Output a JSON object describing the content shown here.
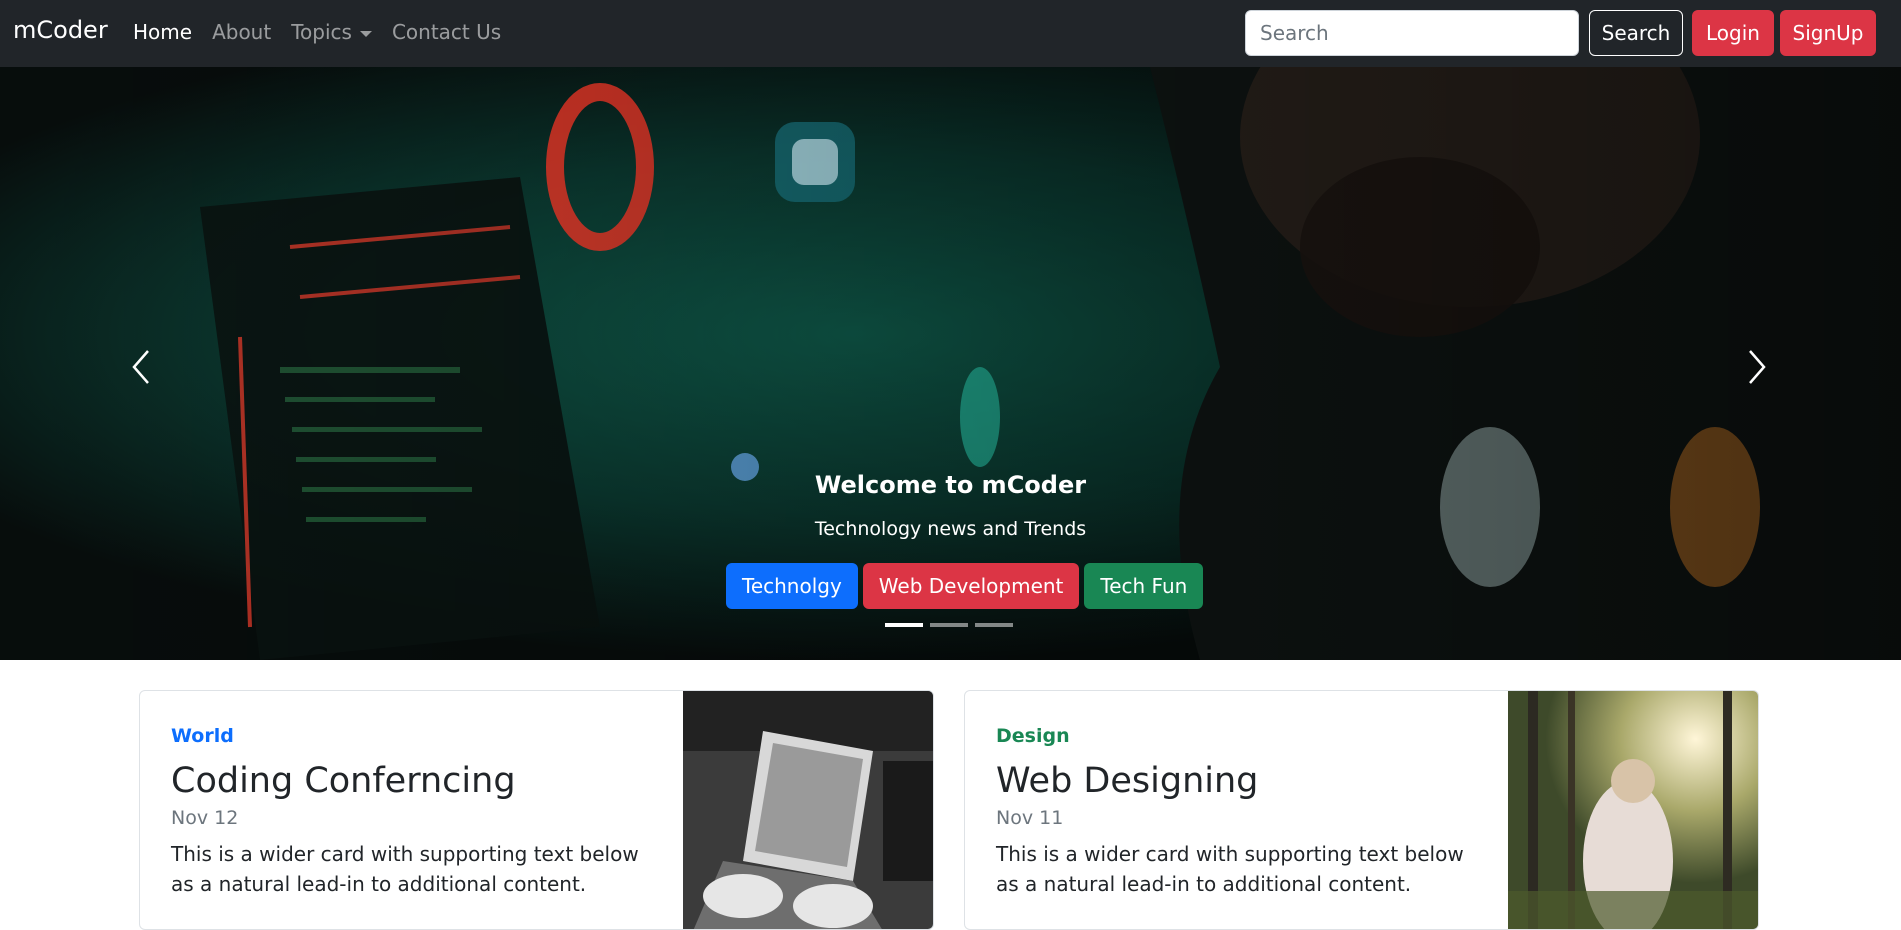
{
  "navbar": {
    "brand": "mCoder",
    "links": [
      {
        "label": "Home",
        "active": true
      },
      {
        "label": "About",
        "active": false
      },
      {
        "label": "Topics",
        "active": false,
        "dropdown": true
      },
      {
        "label": "Contact Us",
        "active": false
      }
    ],
    "search": {
      "placeholder": "Search",
      "value": ""
    },
    "search_button": "Search",
    "login_button": "Login",
    "signup_button": "SignUp"
  },
  "carousel": {
    "caption_title": "Welcome to mCoder",
    "caption_subtitle": "Technology news and Trends",
    "buttons": [
      {
        "label": "Technolgy",
        "color": "#0d6efd"
      },
      {
        "label": "Web Development",
        "color": "#dc3545"
      },
      {
        "label": "Tech Fun",
        "color": "#198754"
      }
    ],
    "active_slide": 1,
    "slide_count": 3
  },
  "cards": [
    {
      "category": "World",
      "category_color": "#0d6efd",
      "title": "Coding Conferncing",
      "date": "Nov 12",
      "text": "This is a wider card with supporting text below as a natural lead-in to additional content."
    },
    {
      "category": "Design",
      "category_color": "#198754",
      "title": "Web Designing",
      "date": "Nov 11",
      "text": "This is a wider card with supporting text below as a natural lead-in to additional content."
    }
  ]
}
